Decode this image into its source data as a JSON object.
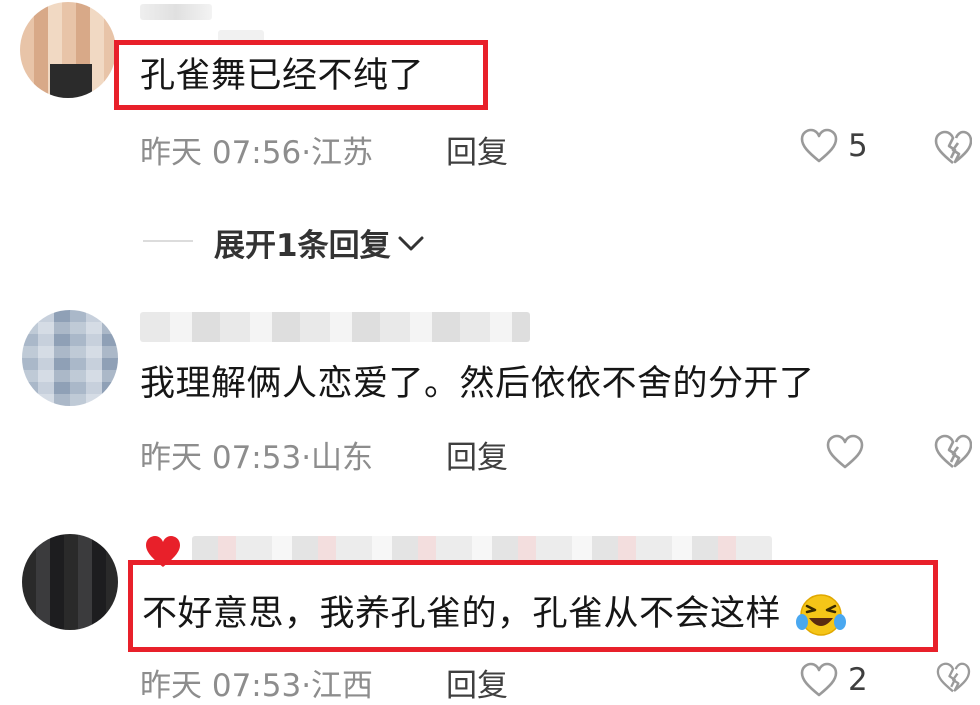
{
  "comments": [
    {
      "text": "孔雀舞已经不纯了",
      "meta": "昨天 07:56·江苏",
      "reply_label": "回复",
      "likes": "5"
    },
    {
      "text": "我理解俩人恋爱了。然后依依不舍的分开了",
      "meta": "昨天 07:53·山东",
      "reply_label": "回复",
      "likes": ""
    },
    {
      "text": "不好意思，我养孔雀的，孔雀从不会这样",
      "meta": "昨天 07:53·江西",
      "reply_label": "回复",
      "likes": "2"
    }
  ],
  "expand_replies_label": "展开1条回复",
  "icons": {
    "like": "heart-outline-icon",
    "dislike": "broken-heart-icon",
    "expand": "chevron-down-icon",
    "emoji": "rofl-emoji-icon",
    "badge": "red-heart-icon"
  },
  "colors": {
    "highlight_box": "#e8202a",
    "meta_text": "#8d8d8d"
  }
}
